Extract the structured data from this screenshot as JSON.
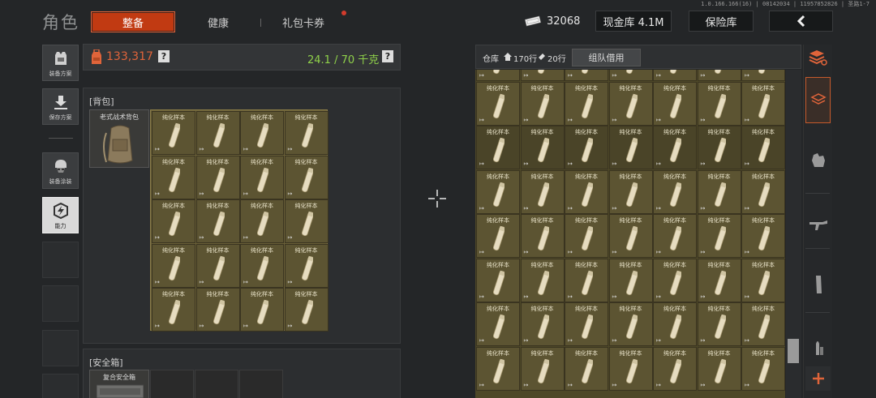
{
  "header": {
    "title": "角色",
    "tabs": [
      {
        "label": "整备",
        "active": true
      },
      {
        "label": "健康",
        "active": false
      },
      {
        "label": "礼包卡券",
        "active": false
      }
    ],
    "version": "1.0.166.166(16) | 08142034 | 11957852826 | 圣路1-7",
    "currency_amount": "32068",
    "cash_vault": "现金库 4.1M",
    "safe_vault": "保险库"
  },
  "left_menu": [
    {
      "label": "装备方案",
      "icon": "vest-icon"
    },
    {
      "label": "保存方案",
      "icon": "download-icon"
    },
    {
      "label": "装备涂装",
      "icon": "helmet-mask-icon"
    },
    {
      "label": "能力",
      "icon": "ability-icon"
    }
  ],
  "equip_stats": {
    "value": "133,317",
    "help": "?",
    "weight": "24.1 / 70 千克",
    "weight_help": "?"
  },
  "backpack": {
    "label": "背包",
    "bag_name": "老式战术背包",
    "item_label": "纯化样本"
  },
  "safe_box": {
    "label": "安全箱",
    "item_name": "复合安全箱"
  },
  "warehouse": {
    "label": "仓库",
    "rows_label": "170行",
    "extra_rows_label": "20行",
    "team_borrow": "组队借用",
    "item_label": "纯化样本"
  },
  "colors": {
    "accent": "#c13a12",
    "value_orange": "#e0643a",
    "weight_green": "#8fd14a",
    "item_bg": "#5c5432"
  }
}
